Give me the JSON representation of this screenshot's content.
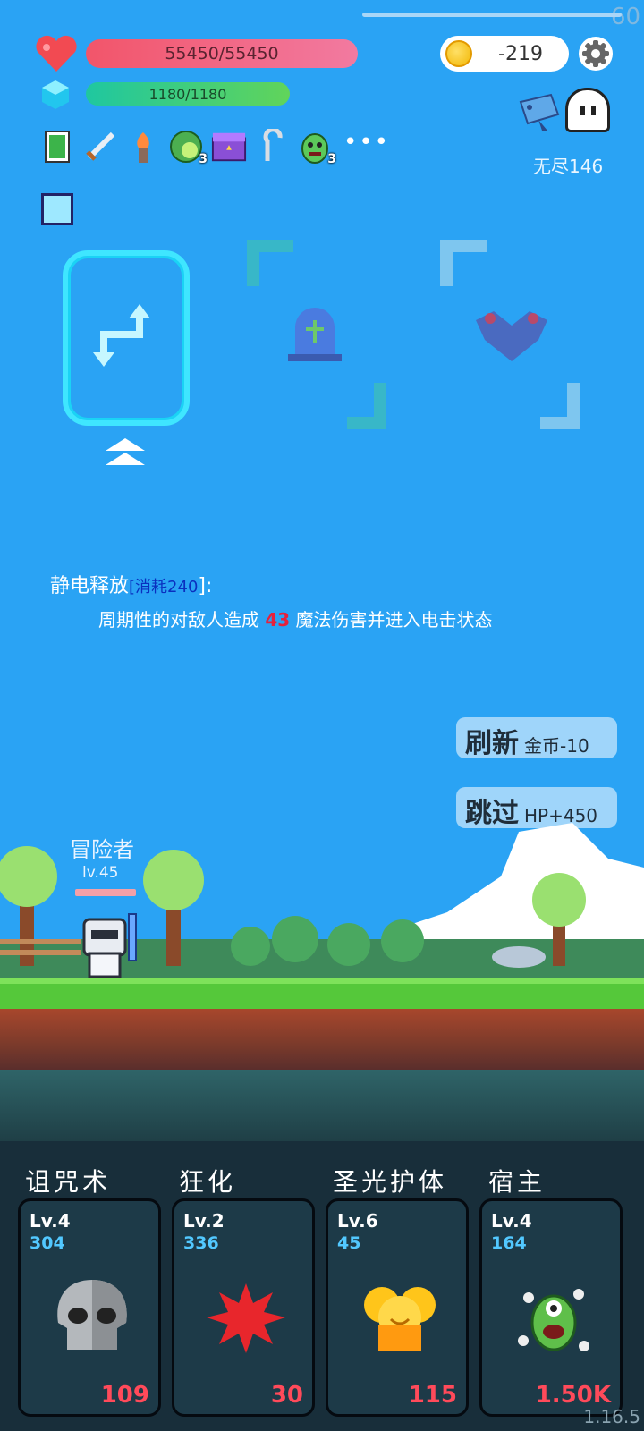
{
  "hud": {
    "fps": "60",
    "hp": "55450/55450",
    "mp": "1180/1180",
    "coins": "-219",
    "mode": "无尽146"
  },
  "items": [
    {
      "name": "green-book-icon",
      "badge": ""
    },
    {
      "name": "sword-icon",
      "badge": ""
    },
    {
      "name": "torch-icon",
      "badge": ""
    },
    {
      "name": "lime-icon",
      "badge": "3"
    },
    {
      "name": "treasure-chest-icon",
      "badge": ""
    },
    {
      "name": "hook-icon",
      "badge": ""
    },
    {
      "name": "green-monster-icon",
      "badge": "3"
    }
  ],
  "more": "•••",
  "choices": [
    {
      "name": "swap-arrows-icon",
      "selected": true
    },
    {
      "name": "tombstone-icon",
      "selected": false
    },
    {
      "name": "gargoyle-icon",
      "selected": false
    }
  ],
  "skill": {
    "name": "静电释放",
    "cost_open": "[",
    "cost": "消耗240",
    "cost_close": "]:",
    "desc_pre": "周期性的对敌人造成 ",
    "damage": "43",
    "desc_post": " 魔法伤害并进入电击状态"
  },
  "buttons": {
    "refresh_label": "刷新",
    "refresh_cost": "金币-10",
    "skip_label": "跳过",
    "skip_reward": "HP+450"
  },
  "player": {
    "name": "冒险者",
    "level": "lv.45"
  },
  "slots": [
    {
      "title": "诅咒术",
      "level": "Lv.4",
      "value": "304",
      "cost": "109",
      "icon": "skull-icon"
    },
    {
      "title": "狂化",
      "level": "Lv.2",
      "value": "336",
      "cost": "30",
      "icon": "red-splat-icon"
    },
    {
      "title": "圣光护体",
      "level": "Lv.6",
      "value": "45",
      "cost": "115",
      "icon": "golden-shield-icon"
    },
    {
      "title": "宿主",
      "level": "Lv.4",
      "value": "164",
      "cost": "1.50K",
      "icon": "eyeball-monster-icon"
    }
  ],
  "version": "1.16.5",
  "colors": {
    "sky": "#2aa3f4",
    "hp": "#f2556a",
    "mp": "#61d45a",
    "selected_card": "#3fe6ff",
    "cost_red": "#ff4a5a",
    "value_blue": "#52c8ff"
  }
}
